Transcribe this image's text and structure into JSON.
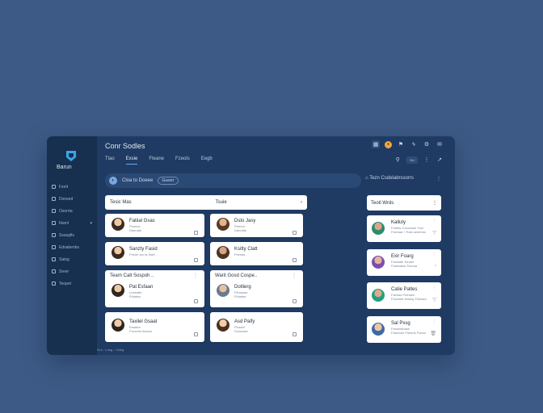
{
  "app": {
    "name": "Barun",
    "title": "Conr Sodles",
    "tabs": [
      "Tlao",
      "Exsie",
      "Fteane",
      "Fzeols",
      "Eegb"
    ]
  },
  "sidebar": {
    "items": [
      {
        "label": "Fzett"
      },
      {
        "label": "Donsed"
      },
      {
        "label": "Osorrta"
      },
      {
        "label": "Itiaml"
      },
      {
        "label": "Ssasgfis"
      },
      {
        "label": "Edsabenbs"
      },
      {
        "label": "Satsg"
      },
      {
        "label": "Sreer"
      },
      {
        "label": "Teopet"
      }
    ]
  },
  "topbar": {
    "right_pill": "Sr.i"
  },
  "search": {
    "text": "Cloa to Doeee",
    "chip": "Gusorr"
  },
  "section_top": {
    "left": "Tesic Mas",
    "right": "Tsuie"
  },
  "cards": [
    {
      "name": "Fatiial Gsas",
      "sub1": "Pounce",
      "sub2": "Dannats"
    },
    {
      "name": "Dsto Jasy",
      "sub1": "Ptreent",
      "sub2": "Dannats"
    },
    {
      "name": "Sanzty Fasid",
      "sub1": "Pxene am ta Salrt",
      "sub2": ""
    },
    {
      "name": "Ksitty Clatt",
      "sub1": "Pxenas",
      "sub2": ""
    },
    {
      "name": "Tearn Calt Sospoh ..",
      "sub1": "Pat Esfaan",
      "sub2": "Lneeatte",
      "extra": "Flotatso"
    },
    {
      "name": "Warit Gosd Cospe..",
      "sub1": "Dotlierg",
      "sub2": "Plenasse",
      "extra": "Flotatse"
    },
    {
      "name": "Taxilel Gsaat",
      "sub1": "Esaaria",
      "sub2": "Freomts Aaaore",
      "extra": ""
    },
    {
      "name": "Asd Palfy",
      "sub1": "Plusenl",
      "sub2": "Donisase",
      "extra": ""
    }
  ],
  "right_panel": {
    "title": "Tezn Csdelabrssorrs",
    "list_header": "Teotl Wrds",
    "people": [
      {
        "name": "Kalluty",
        "sub1": "Forteis Colooosel Tuer",
        "sub2": "Fcsmaa + Satc sedenss"
      },
      {
        "name": "Exir Foarg",
        "sub1": "Faoisats Tonast",
        "sub2": "Fsaesaisa Tcsnaa"
      },
      {
        "name": "Catie Patles",
        "sub1": "Faesad Fsrnaes",
        "sub2": "Fsesdeb Ilrmtdy Fsessfa"
      },
      {
        "name": "Sal Pxsg",
        "sub1": "Fesandinase",
        "sub2": "Fawesee Faesrts Fsesa"
      }
    ]
  },
  "footer": "Sr.s : Loeg :: Cbbg"
}
